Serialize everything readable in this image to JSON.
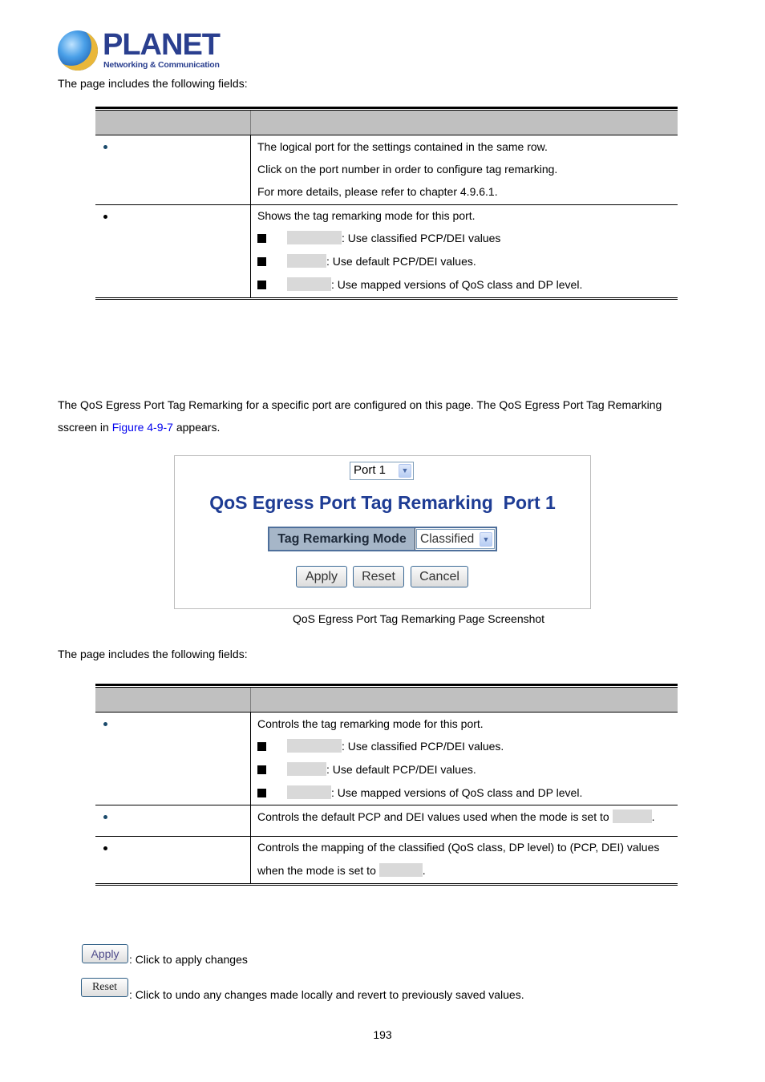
{
  "logo": {
    "brand": "PLANET",
    "tagline": "Networking & Communication"
  },
  "intro1": "The page includes the following fields:",
  "table1": {
    "header": [
      "",
      ""
    ],
    "rows": [
      {
        "field": "",
        "lines": [
          "The logical port for the settings contained in the same row.",
          "Click on the port number in order to configure tag remarking.",
          "For more details, please refer to chapter 4.9.6.1."
        ]
      },
      {
        "field": "",
        "intro": "Shows the tag remarking mode for this port.",
        "options": [
          {
            "name": "",
            "desc": ": Use classified PCP/DEI values"
          },
          {
            "name": "",
            "desc": ": Use default PCP/DEI values."
          },
          {
            "name": "",
            "desc": ": Use mapped versions of QoS class and DP level."
          }
        ]
      }
    ]
  },
  "description": {
    "line1": "The QoS Egress Port Tag Remarking for a specific port are configured on this page. The QoS Egress Port Tag Remarking",
    "line2_prefix": "sscreen in ",
    "line2_link": "Figure 4-9-7",
    "line2_suffix": " appears."
  },
  "screenshot": {
    "port_select": "Port 1",
    "title": "QoS Egress Port Tag Remarking  Port 1",
    "mode_label": "Tag Remarking Mode",
    "mode_value": "Classified",
    "buttons": {
      "apply": "Apply",
      "reset": "Reset",
      "cancel": "Cancel"
    },
    "arrow_glyph": "⌵",
    "colors": {
      "title": "#1e3c94",
      "label_bg": "#a6b6c8",
      "border": "#4e6f9b"
    }
  },
  "caption": "QoS Egress Port Tag Remarking Page Screenshot",
  "intro2": "The page includes the following fields:",
  "table2": {
    "header": [
      "",
      ""
    ],
    "rows": [
      {
        "field": "",
        "intro": "Controls the tag remarking mode for this port.",
        "options": [
          {
            "name": "",
            "desc": ": Use classified PCP/DEI values."
          },
          {
            "name": "",
            "desc": ": Use default PCP/DEI values."
          },
          {
            "name": "",
            "desc": ": Use mapped versions of QoS class and DP level."
          }
        ]
      },
      {
        "field": "",
        "text": "Controls the default PCP and DEI values used when the mode is set to ",
        "suffix": "."
      },
      {
        "field": "",
        "line1": "Controls the mapping of the classified (QoS class, DP level) to (PCP, DEI) values",
        "line2": "when the mode is set to ",
        "suffix": "."
      }
    ]
  },
  "buttons_help": [
    {
      "button": "Apply",
      "desc": ": Click to apply changes"
    },
    {
      "button": "Reset",
      "desc": ": Click to undo any changes made locally and revert to previously saved values."
    }
  ],
  "page_number": "193"
}
